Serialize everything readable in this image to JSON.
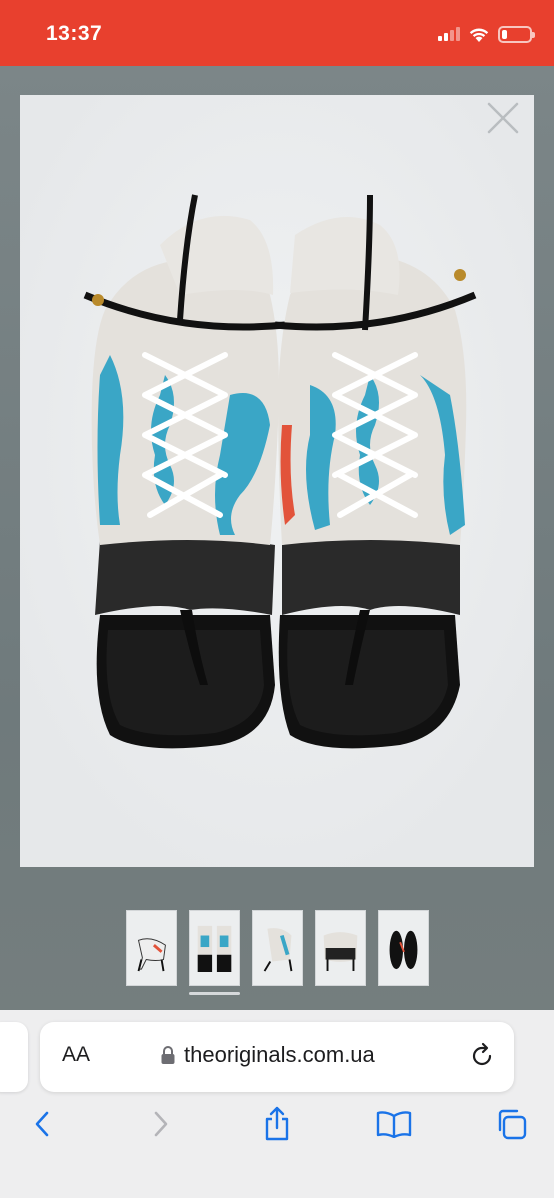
{
  "status_bar": {
    "time": "13:37",
    "icons": [
      "signal-icon",
      "wifi-icon",
      "battery-icon"
    ],
    "battery_level": 0.2,
    "color": "#e8402e"
  },
  "viewer": {
    "close_icon": "close-icon",
    "image_description_icon": "product-photo",
    "thumbnails": [
      "thumbnail-1",
      "thumbnail-2",
      "thumbnail-3",
      "thumbnail-4",
      "thumbnail-5"
    ],
    "selected_thumbnail": 2
  },
  "browser": {
    "aa_label": "AA",
    "lock_icon": "lock-icon",
    "url": "theoriginals.com.ua",
    "reload_icon": "reload-icon",
    "toolbar": [
      "back-icon",
      "forward-icon",
      "share-icon",
      "bookmarks-icon",
      "tabs-icon"
    ],
    "accent": "#1a73e8"
  }
}
